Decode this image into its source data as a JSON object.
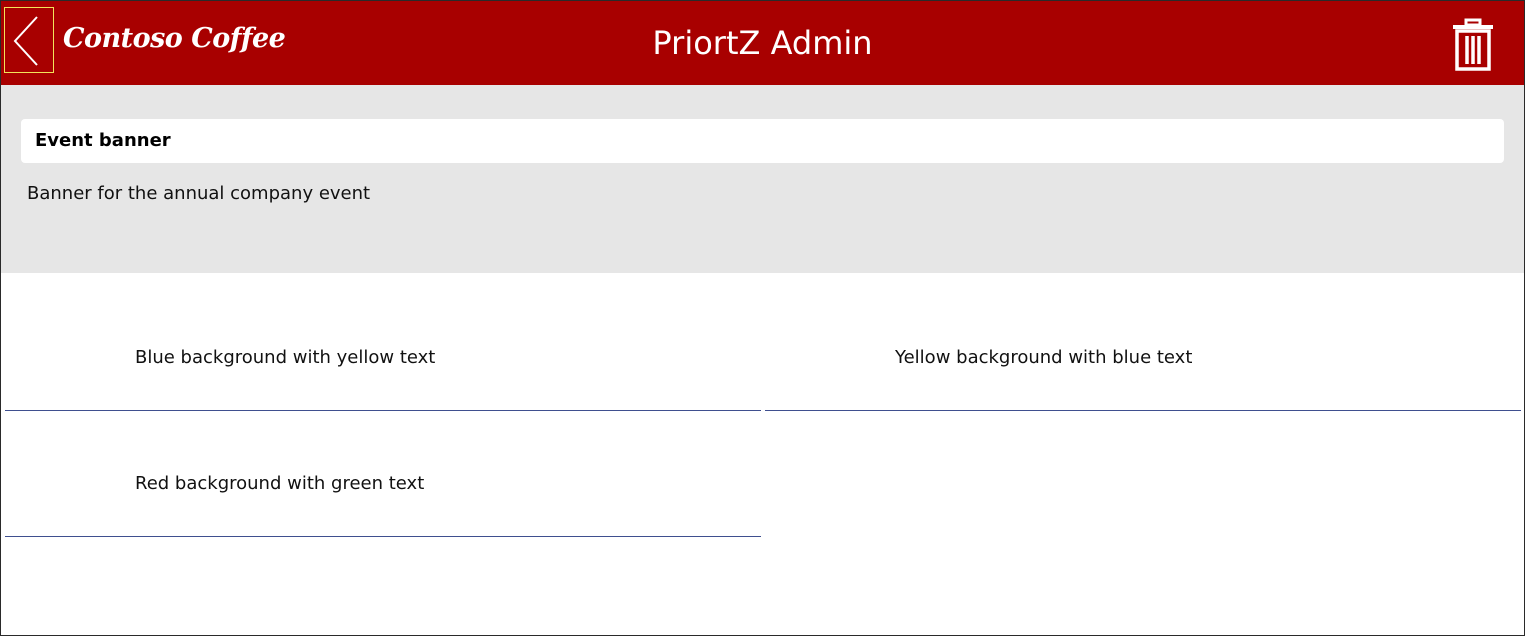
{
  "header": {
    "brand": "Contoso Coffee",
    "title": "PriortZ Admin",
    "back_icon": "chevron-left-icon",
    "delete_icon": "trash-icon",
    "background_color": "#a80000",
    "focus_outline_color": "#f2e35a"
  },
  "details": {
    "title": "Event banner",
    "description": "Banner for the annual company event",
    "background_color": "#e6e6e6"
  },
  "gallery": {
    "items": [
      {
        "label": "Blue background with yellow text"
      },
      {
        "label": "Yellow background with blue text"
      },
      {
        "label": "Red background with green text"
      }
    ],
    "separator_color": "#3f4f8f"
  }
}
